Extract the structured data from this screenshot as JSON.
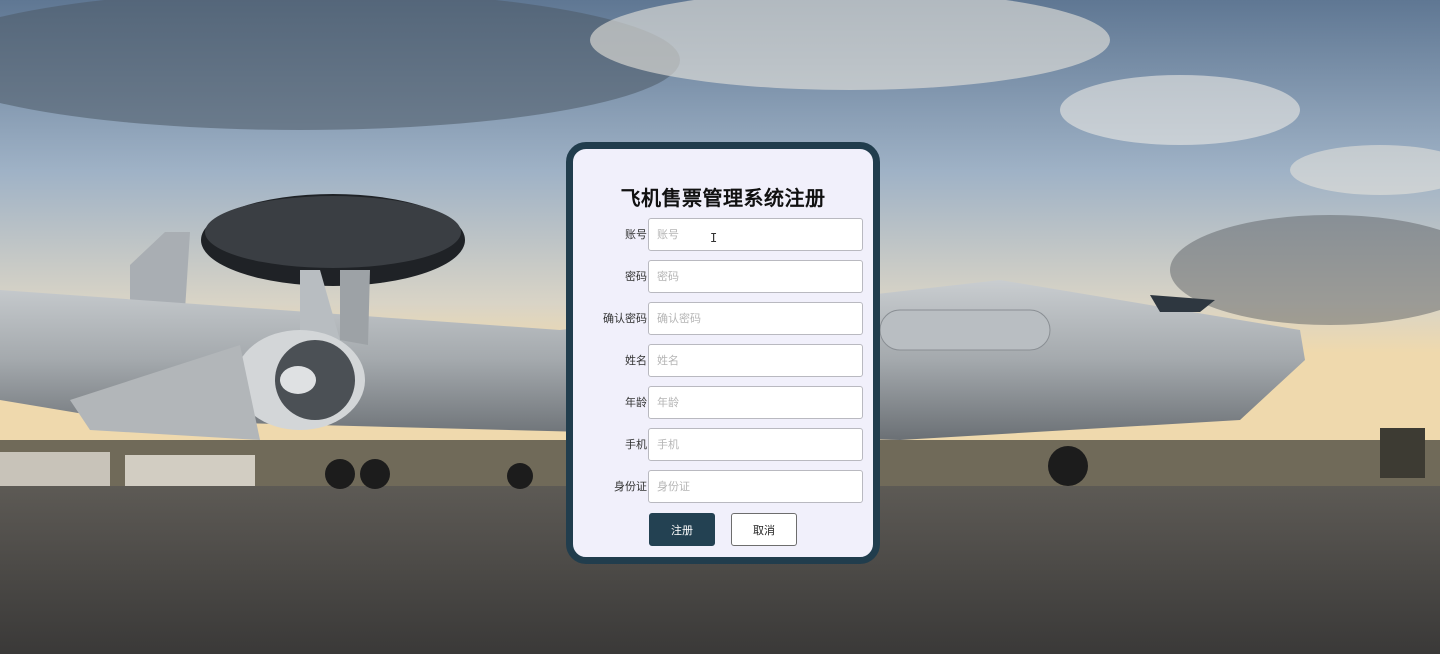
{
  "form": {
    "title": "飞机售票管理系统注册",
    "fields": [
      {
        "label": "账号",
        "placeholder": "账号",
        "value": ""
      },
      {
        "label": "密码",
        "placeholder": "密码",
        "value": ""
      },
      {
        "label": "确认密码",
        "placeholder": "确认密码",
        "value": ""
      },
      {
        "label": "姓名",
        "placeholder": "姓名",
        "value": ""
      },
      {
        "label": "年龄",
        "placeholder": "年龄",
        "value": ""
      },
      {
        "label": "手机",
        "placeholder": "手机",
        "value": ""
      },
      {
        "label": "身份证",
        "placeholder": "身份证",
        "value": ""
      }
    ],
    "register_label": "注册",
    "cancel_label": "取消"
  },
  "colors": {
    "card_border": "#213d4d",
    "card_bg": "#f1f0fb",
    "primary_button": "#234152"
  },
  "background": {
    "icon": "awacs-aircraft-photo"
  }
}
